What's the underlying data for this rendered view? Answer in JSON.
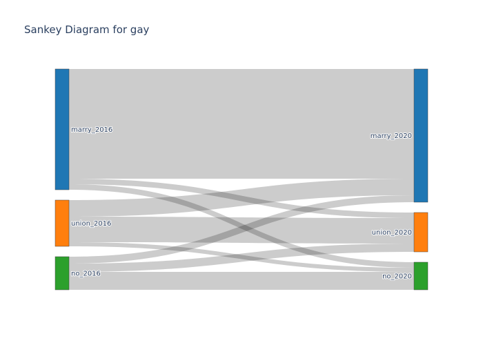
{
  "title": "Sankey Diagram for gay",
  "chart_data": {
    "type": "sankey",
    "title": "Sankey Diagram for gay",
    "nodes": [
      {
        "id": "marry_2016",
        "label": "marry_2016",
        "column": 0,
        "color": "#1f77b4"
      },
      {
        "id": "union_2016",
        "label": "union_2016",
        "column": 0,
        "color": "#ff7f0e"
      },
      {
        "id": "no_2016",
        "label": "no_2016",
        "column": 0,
        "color": "#2ca02c"
      },
      {
        "id": "marry_2020",
        "label": "marry_2020",
        "column": 1,
        "color": "#1f77b4"
      },
      {
        "id": "union_2020",
        "label": "union_2020",
        "column": 1,
        "color": "#ff7f0e"
      },
      {
        "id": "no_2020",
        "label": "no_2020",
        "column": 1,
        "color": "#2ca02c"
      }
    ],
    "links": [
      {
        "source": "marry_2016",
        "target": "marry_2020",
        "value": 159
      },
      {
        "source": "marry_2016",
        "target": "union_2020",
        "value": 8
      },
      {
        "source": "marry_2016",
        "target": "no_2020",
        "value": 8
      },
      {
        "source": "union_2016",
        "target": "marry_2020",
        "value": 24
      },
      {
        "source": "union_2016",
        "target": "union_2020",
        "value": 37
      },
      {
        "source": "union_2016",
        "target": "no_2020",
        "value": 6
      },
      {
        "source": "no_2016",
        "target": "marry_2020",
        "value": 10
      },
      {
        "source": "no_2016",
        "target": "union_2020",
        "value": 12
      },
      {
        "source": "no_2016",
        "target": "no_2020",
        "value": 26
      }
    ],
    "link_color": "rgba(0,0,0,0.2)",
    "node_outline": "#444444"
  }
}
